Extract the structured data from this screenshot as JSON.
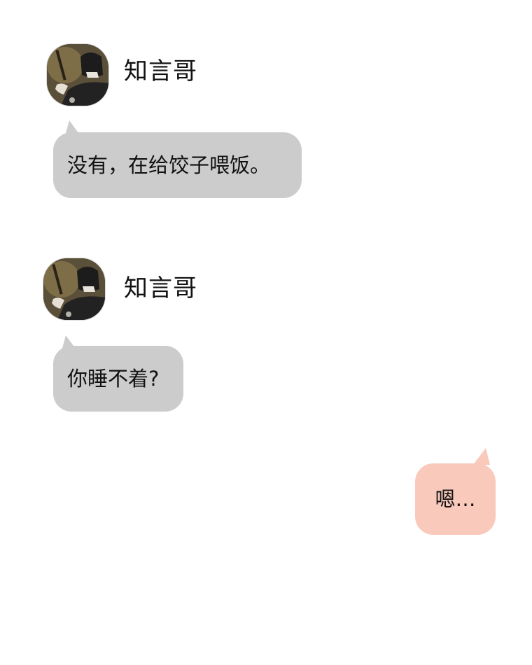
{
  "messages": [
    {
      "sender": "知言哥",
      "text": "没有，在给饺子喂饭。",
      "side": "left"
    },
    {
      "sender": "知言哥",
      "text": "你睡不着?",
      "side": "left"
    },
    {
      "sender": "",
      "text": "嗯…",
      "side": "right"
    }
  ],
  "colors": {
    "incoming_bubble": "#cccccc",
    "outgoing_bubble": "#f9c9bb",
    "background": "#ffffff"
  }
}
